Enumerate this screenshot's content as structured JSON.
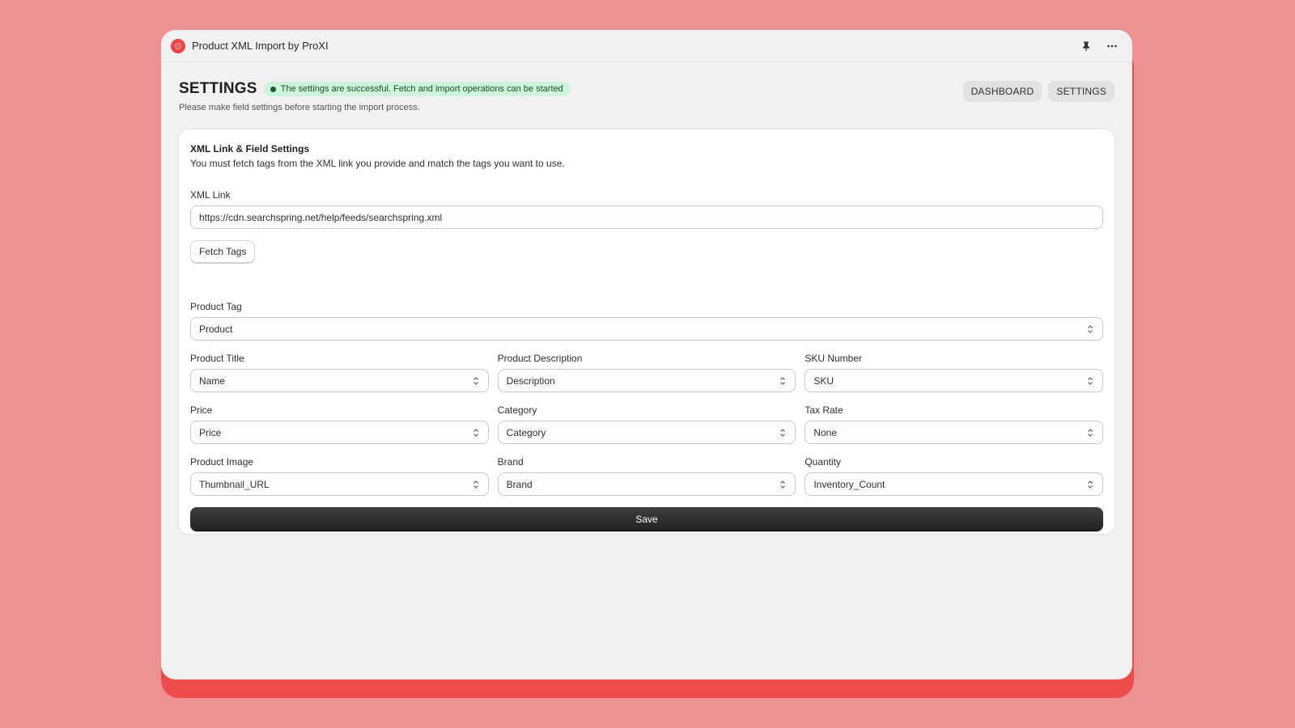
{
  "window": {
    "app_title": "Product XML Import by ProXI",
    "icons": {
      "logo": "app-logo-icon",
      "pin": "pin-icon",
      "more": "more-horizontal-icon"
    }
  },
  "header": {
    "title": "SETTINGS",
    "status_badge": "The settings are successful. Fetch and import operations can be started",
    "subtitle": "Please make field settings before starting the import process.",
    "nav": [
      {
        "label": "DASHBOARD"
      },
      {
        "label": "SETTINGS"
      }
    ]
  },
  "card": {
    "title": "XML Link & Field Settings",
    "description": "You must fetch tags from the XML link you provide and match the tags you want to use.",
    "xml_link": {
      "label": "XML Link",
      "value": "https://cdn.searchspring.net/help/feeds/searchspring.xml"
    },
    "fetch_button": "Fetch Tags",
    "product_tag": {
      "label": "Product Tag",
      "value": "Product"
    },
    "fields": [
      {
        "label": "Product Title",
        "value": "Name"
      },
      {
        "label": "Product Description",
        "value": "Description"
      },
      {
        "label": "SKU Number",
        "value": "SKU"
      },
      {
        "label": "Price",
        "value": "Price"
      },
      {
        "label": "Category",
        "value": "Category"
      },
      {
        "label": "Tax Rate",
        "value": "None"
      },
      {
        "label": "Product Image",
        "value": "Thumbnail_URL"
      },
      {
        "label": "Brand",
        "value": "Brand"
      },
      {
        "label": "Quantity",
        "value": "Inventory_Count"
      }
    ],
    "save_button": "Save"
  },
  "colors": {
    "background": "#ec9292",
    "accent_red": "#ee4b4b",
    "success_badge_bg": "#cdf5d9",
    "save_button": "#2b2b2b"
  }
}
